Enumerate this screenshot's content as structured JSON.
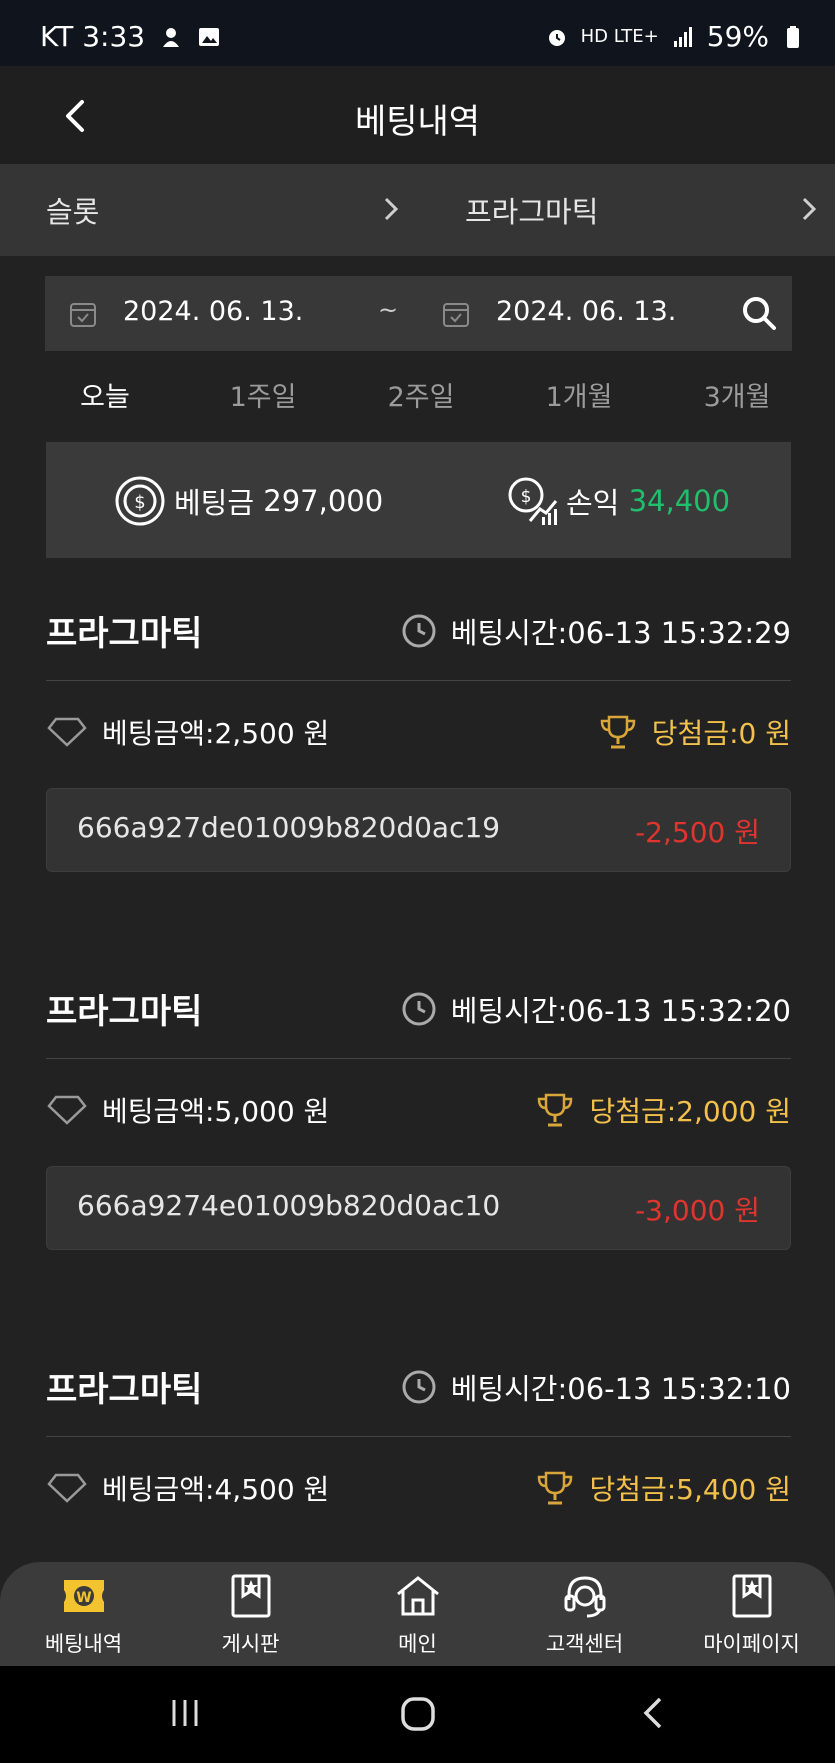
{
  "status_bar": {
    "carrier_time": "KT 3:33",
    "network": "HD LTE+",
    "battery": "59%"
  },
  "app_bar": {
    "title": "베팅내역"
  },
  "category": {
    "left": "슬롯",
    "right": "프라그마틱"
  },
  "date_filter": {
    "start": "2024. 06. 13.",
    "separator": "~",
    "end": "2024. 06. 13."
  },
  "periods": [
    "오늘",
    "1주일",
    "2주일",
    "1개월",
    "3개월"
  ],
  "active_period": 0,
  "summary": {
    "bet_label": "베팅금",
    "bet_value": "297,000",
    "profit_label": "손익",
    "profit_value": "34,400"
  },
  "entries": [
    {
      "name": "프라그마틱",
      "time": "베팅시간:06-13 15:32:29",
      "bet": "베팅금액:2,500 원",
      "win": "당첨금:0 원",
      "id": "666a927de01009b820d0ac19",
      "diff": "-2,500 원"
    },
    {
      "name": "프라그마틱",
      "time": "베팅시간:06-13 15:32:20",
      "bet": "베팅금액:5,000 원",
      "win": "당첨금:2,000 원",
      "id": "666a9274e01009b820d0ac10",
      "diff": "-3,000 원"
    },
    {
      "name": "프라그마틱",
      "time": "베팅시간:06-13 15:32:10",
      "bet": "베팅금액:4,500 원",
      "win": "당첨금:5,400 원",
      "id": "",
      "diff": ""
    }
  ],
  "bottom_nav": [
    "베팅내역",
    "게시판",
    "메인",
    "고객센터",
    "마이페이지"
  ],
  "colors": {
    "profit_positive": "#1fbf6b",
    "loss": "#e0342e",
    "win_gold": "#f3c14b",
    "active_tab": "#f4c430"
  }
}
